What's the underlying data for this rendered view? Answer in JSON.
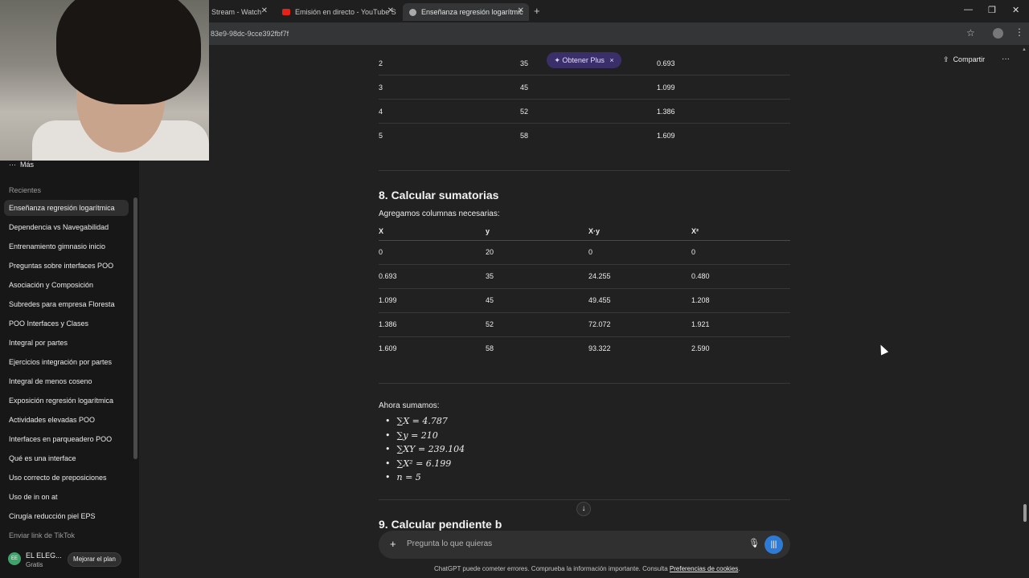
{
  "browser": {
    "tabs": [
      {
        "label": "Stream - Watch",
        "active": false
      },
      {
        "label": "Emisión en directo - YouTube S",
        "active": false
      },
      {
        "label": "Enseñanza regresión logarítmic",
        "active": true
      }
    ],
    "url": "83e9-98dc-9cce392fbf7f",
    "window_controls": [
      "—",
      "❐",
      "✕"
    ]
  },
  "sidebar": {
    "more_label": "Más",
    "recent_heading": "Recientes",
    "items": [
      "Enseñanza regresión logarítmica",
      "Dependencia vs Navegabilidad",
      "Entrenamiento gimnasio inicio",
      "Preguntas sobre interfaces POO",
      "Asociación y Composición",
      "Subredes para empresa Floresta",
      "POO Interfaces y Clases",
      "Integral por partes",
      "Ejercicios integración por partes",
      "Integral de menos coseno",
      "Exposición regresión logarítmica",
      "Actividades elevadas POO",
      "Interfaces en parqueadero POO",
      "Qué es una interface",
      "Uso correcto de preposiciones",
      "Uso de in on at",
      "Cirugía reducción piel EPS",
      "Enviar link de TikTok"
    ],
    "user": {
      "initials": "EE",
      "name": "EL ELEG...",
      "plan": "Gratis"
    },
    "upgrade_label": "Mejorar el plan"
  },
  "header": {
    "share_label": "Compartir",
    "plus_pill_label": "Obtener Plus",
    "plus_close": "×"
  },
  "table_top": {
    "rows": [
      [
        "2",
        "35",
        "0.693"
      ],
      [
        "3",
        "45",
        "1.099"
      ],
      [
        "4",
        "52",
        "1.386"
      ],
      [
        "5",
        "58",
        "1.609"
      ]
    ]
  },
  "section8": {
    "title": "8. Calcular sumatorias",
    "intro": "Agregamos columnas necesarias:",
    "headers": [
      "X",
      "y",
      "X·y",
      "X²"
    ],
    "rows": [
      [
        "0",
        "20",
        "0",
        "0"
      ],
      [
        "0.693",
        "35",
        "24.255",
        "0.480"
      ],
      [
        "1.099",
        "45",
        "49.455",
        "1.208"
      ],
      [
        "1.386",
        "52",
        "72.072",
        "1.921"
      ],
      [
        "1.609",
        "58",
        "93.322",
        "2.590"
      ]
    ]
  },
  "sums": {
    "intro": "Ahora sumamos:",
    "items": [
      "∑X = 4.787",
      "∑y = 210",
      "∑XY = 239.104",
      "∑X² = 6.199",
      "n = 5"
    ]
  },
  "section9": {
    "title": "9. Calcular pendiente b"
  },
  "composer": {
    "placeholder": "Pregunta lo que quieras"
  },
  "disclaimer": {
    "text": "ChatGPT puede cometer errores. Comprueba la información importante. Consulta ",
    "link": "Preferencias de cookies",
    "end": "."
  }
}
